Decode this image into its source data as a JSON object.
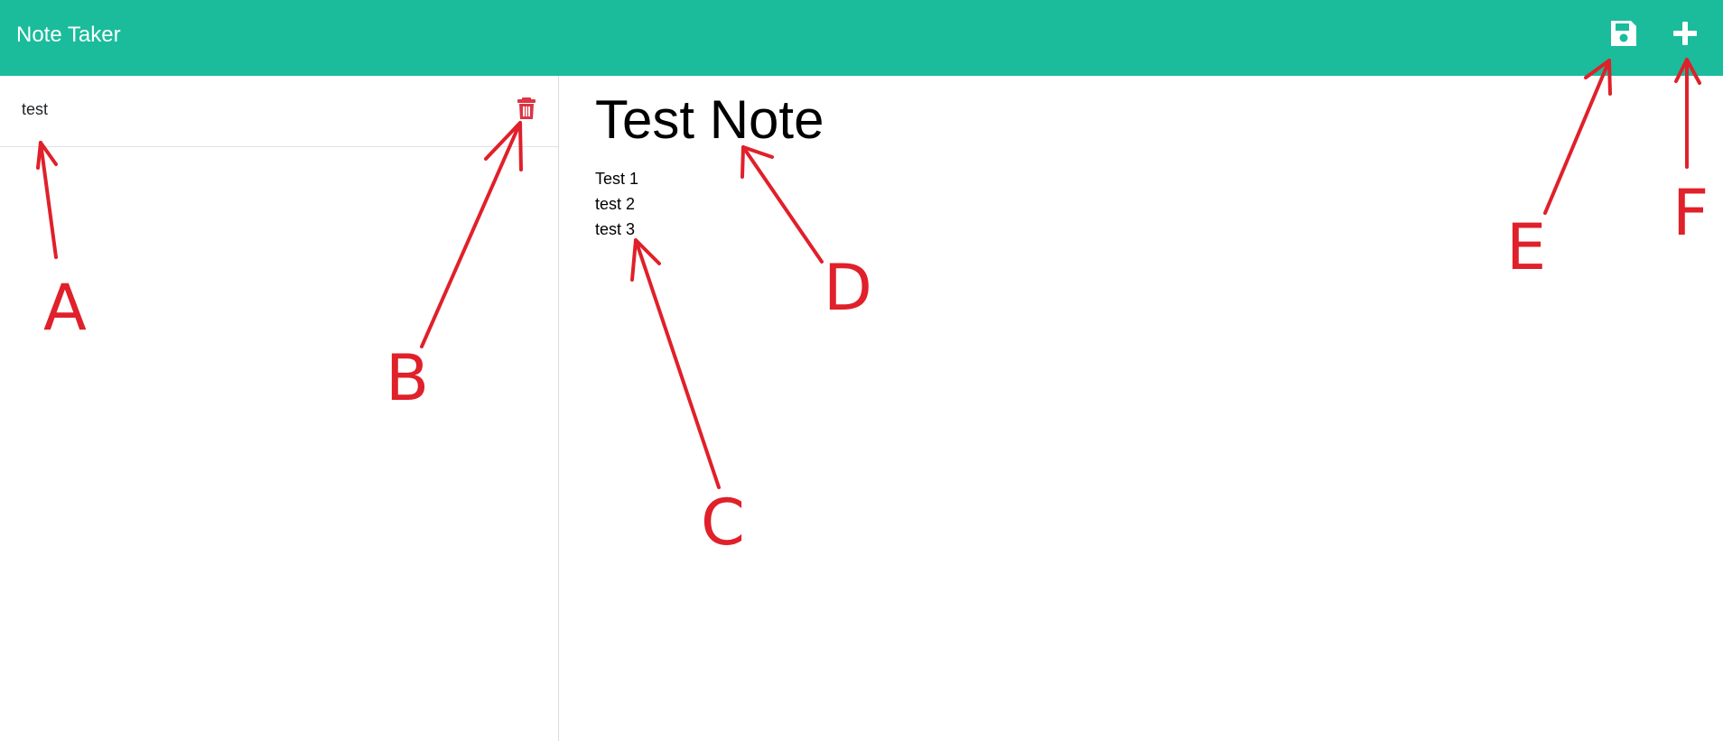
{
  "navbar": {
    "brand": "Note Taker",
    "save_icon": "floppy-disk-icon",
    "new_icon": "plus-icon",
    "background": "#1abc9c"
  },
  "sidebar": {
    "notes": [
      {
        "label": "test",
        "delete_icon": "trash-icon",
        "delete_color": "#dc3545"
      }
    ]
  },
  "editor": {
    "title": "Test Note",
    "body_lines": [
      "Test 1",
      "test 2",
      "test 3"
    ]
  },
  "annotations": {
    "color": "#e0202a",
    "labels": [
      "A",
      "B",
      "C",
      "D",
      "E",
      "F"
    ]
  }
}
